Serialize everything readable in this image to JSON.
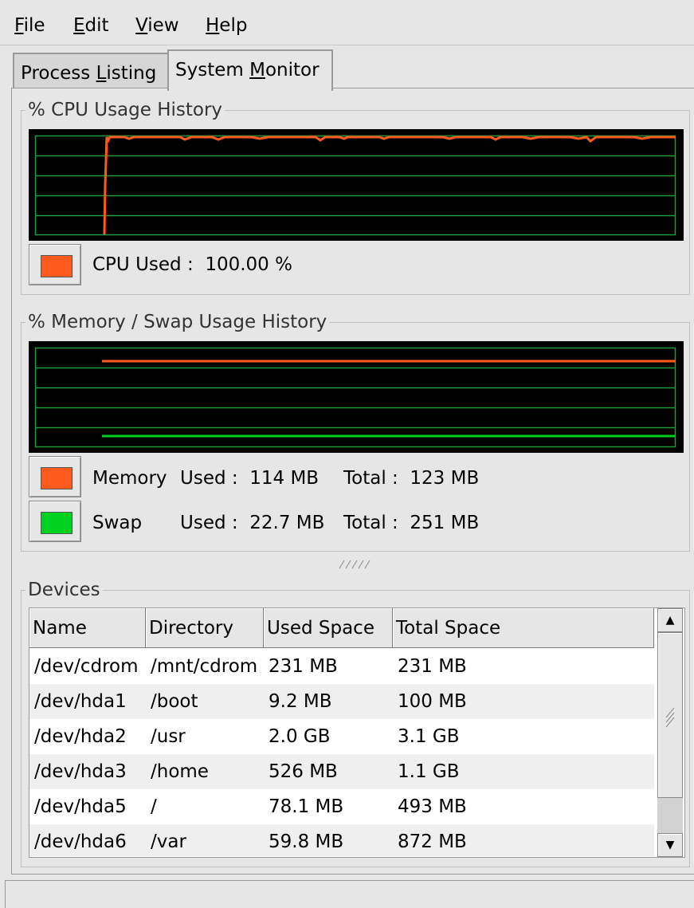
{
  "menu": {
    "file": {
      "mnemonic": "F",
      "rest": "ile"
    },
    "edit": {
      "mnemonic": "E",
      "rest": "dit"
    },
    "view": {
      "mnemonic": "V",
      "rest": "iew"
    },
    "help": {
      "mnemonic": "H",
      "rest": "elp"
    }
  },
  "tabs": {
    "process": {
      "pre": "Process ",
      "mnemonic": "L",
      "post": "isting"
    },
    "system": {
      "pre": "System ",
      "mnemonic": "M",
      "post": "onitor"
    }
  },
  "cpu": {
    "title": "% CPU Usage History",
    "legend": "CPU Used :  100.00 %",
    "color": "#ff5a1e",
    "used_percent": 100.0
  },
  "memory": {
    "title": "% Memory / Swap Usage History",
    "mem_name": "Memory",
    "mem_used": "Used :  114 MB",
    "mem_total": "Total :  123 MB",
    "swap_name": "Swap",
    "swap_used": "Used :  22.7 MB",
    "swap_total": "Total :  251 MB",
    "mem_color": "#ff5a1e",
    "swap_color": "#00d020"
  },
  "devices": {
    "title": "Devices",
    "columns": [
      "Name",
      "Directory",
      "Used Space",
      "Total Space"
    ],
    "rows": [
      [
        "/dev/cdrom",
        "/mnt/cdrom",
        "231 MB",
        "231 MB"
      ],
      [
        "/dev/hda1",
        "/boot",
        "9.2 MB",
        "100 MB"
      ],
      [
        "/dev/hda2",
        "/usr",
        "2.0 GB",
        "3.1 GB"
      ],
      [
        "/dev/hda3",
        "/home",
        "526 MB",
        "1.1 GB"
      ],
      [
        "/dev/hda5",
        "/",
        "78.1 MB",
        "493 MB"
      ],
      [
        "/dev/hda6",
        "/var",
        "59.8 MB",
        "872 MB"
      ]
    ]
  },
  "colors": {
    "graph_bg": "#000000",
    "grid": "#1e9a3a"
  }
}
